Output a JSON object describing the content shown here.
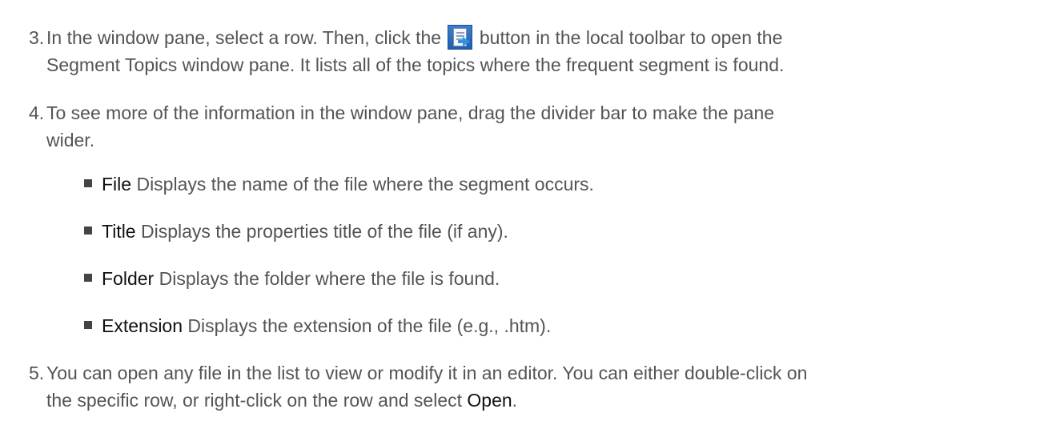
{
  "steps": [
    {
      "number": "3.",
      "line1_before_icon": "In the window pane, select a row. Then, click the",
      "icon": "open-topics-icon",
      "line1_after_icon": "button in the local toolbar to open the",
      "line2": "Segment Topics window pane. It lists all of the topics where the frequent segment is found."
    },
    {
      "number": "4.",
      "line1": "To see more of the information in the window pane, drag the divider bar to make the pane",
      "line2": "wider."
    },
    {
      "number": "5.",
      "line1": "You can open any file in the list to view or modify it in an editor. You can either double-click on",
      "line2_before": "the specific row, or right-click on the row and select",
      "line2_term": "Open",
      "line2_after": "."
    }
  ],
  "bullets": [
    {
      "term": "File",
      "text": "Displays the name of the file where the segment occurs."
    },
    {
      "term": "Title",
      "text": "Displays the properties title of the file (if any)."
    },
    {
      "term": "Folder",
      "text": "Displays the folder where the file is found."
    },
    {
      "term": "Extension",
      "text": "Displays the extension of the file (e.g., .htm)."
    }
  ],
  "colors": {
    "body_text": "#545454",
    "term_text": "#111111",
    "bullet": "#444444",
    "icon_blue": "#2e6fc0"
  }
}
